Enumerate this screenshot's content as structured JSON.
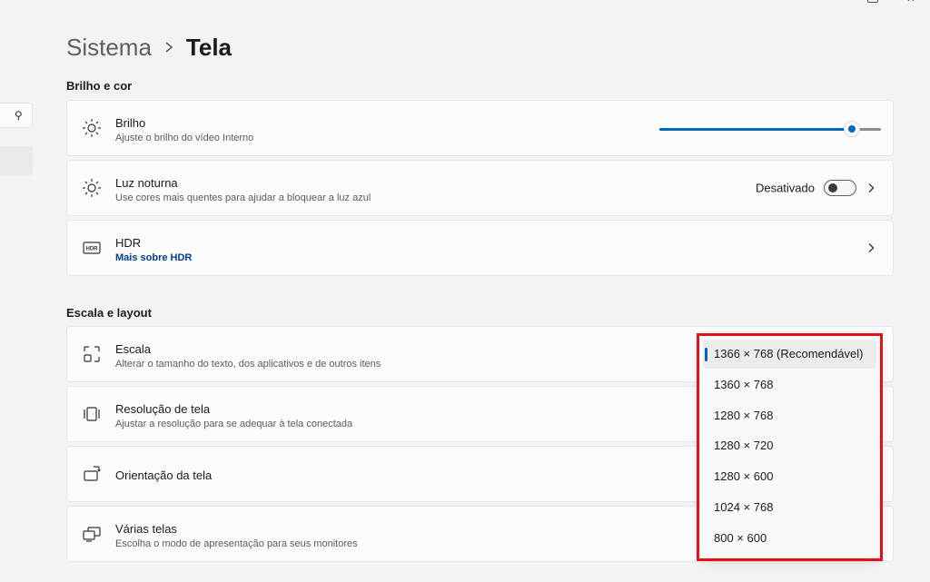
{
  "header": {
    "parent": "Sistema",
    "current": "Tela"
  },
  "sections": {
    "brightness_color": "Brilho e cor",
    "scale_layout": "Escala e layout"
  },
  "brightness": {
    "title": "Brilho",
    "subtitle": "Ajuste o brilho do vídeo Interno",
    "level_percent": 87,
    "icon": "sun-icon"
  },
  "night_light": {
    "title": "Luz noturna",
    "subtitle": "Use cores mais quentes para ajudar a bloquear a luz azul",
    "status": "Desativado",
    "enabled": false,
    "icon": "night-light-icon"
  },
  "hdr": {
    "title": "HDR",
    "link": "Mais sobre HDR",
    "icon": "hdr-icon"
  },
  "scale": {
    "title": "Escala",
    "subtitle": "Alterar o tamanho do texto, dos aplicativos e de outros itens",
    "icon": "scale-icon"
  },
  "resolution": {
    "title": "Resolução de tela",
    "subtitle": "Ajustar a resolução para se adequar à tela conectada",
    "icon": "resolution-icon"
  },
  "orientation": {
    "title": "Orientação da tela",
    "icon": "orientation-icon"
  },
  "multiple_displays": {
    "title": "Várias telas",
    "subtitle": "Escolha o modo de apresentação para seus monitores",
    "icon": "multiple-displays-icon"
  },
  "resolution_dropdown": {
    "selected_index": 0,
    "options": [
      "1366 × 768 (Recomendável)",
      "1360 × 768",
      "1280 × 768",
      "1280 × 720",
      "1280 × 600",
      "1024 × 768",
      "800 × 600"
    ]
  },
  "colors": {
    "accent": "#0067c0",
    "highlight_box": "#e1131a",
    "link": "#003e92"
  }
}
